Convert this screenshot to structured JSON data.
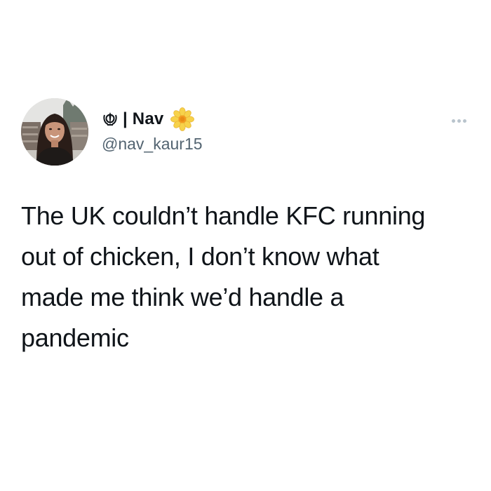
{
  "tweet": {
    "author": {
      "display_name": "Nav",
      "name_prefix_icon": "khanda-icon",
      "name_suffix_icon": "blossom-icon",
      "handle": "@nav_kaur15",
      "avatar": "avatar-photo"
    },
    "more_icon": "more-options-icon",
    "text_lines": [
      "The UK couldn’t handle KFC running",
      "out of chicken, I don’t know what",
      "made me think we’d handle a",
      "pandemic"
    ]
  },
  "colors": {
    "background": "#ffffff",
    "text_primary": "#0f1419",
    "text_secondary": "#536471",
    "more_dots": "#b9c4cd"
  }
}
